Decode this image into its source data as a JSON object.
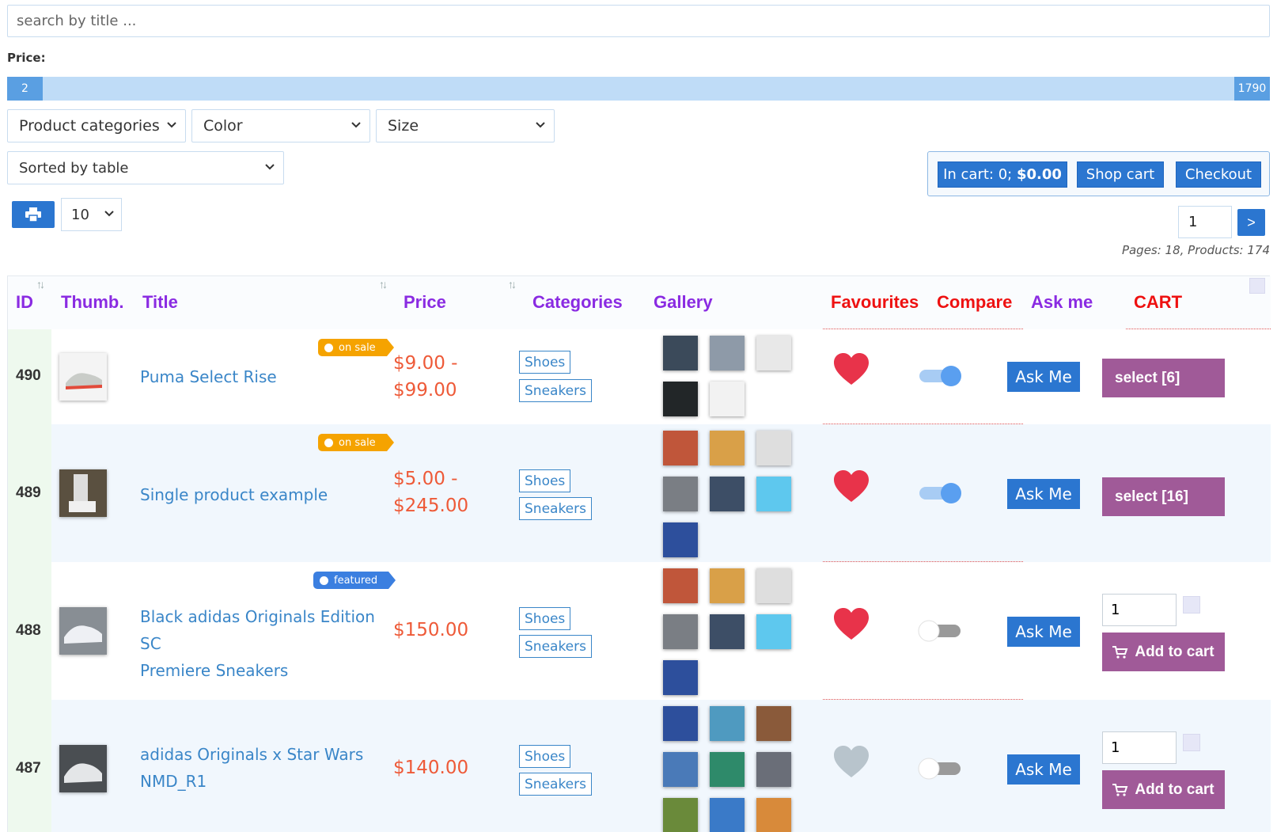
{
  "search": {
    "placeholder": "search by title ..."
  },
  "price": {
    "label": "Price:",
    "min": "2",
    "max": "1790"
  },
  "filters": {
    "categories": "Product categories",
    "color": "Color",
    "size": "Size"
  },
  "sort": {
    "selected": "Sorted by table"
  },
  "cart": {
    "in_cart_prefix": "In cart: 0; ",
    "in_cart_total": "$0.00",
    "shop_cart": "Shop cart",
    "checkout": "Checkout"
  },
  "per_page": {
    "selected": "10"
  },
  "pagination": {
    "page": "1",
    "next": ">",
    "info": "Pages: 18, Products: 174"
  },
  "table": {
    "headers": {
      "id": "ID",
      "thumb": "Thumb.",
      "title": "Title",
      "price": "Price",
      "categories": "Categories",
      "gallery": "Gallery",
      "favourites": "Favourites",
      "compare": "Compare",
      "ask": "Ask me",
      "cart": "CART"
    },
    "rows": [
      {
        "id": "490",
        "title": "Puma Select Rise",
        "badge": "on sale",
        "price_line1": "$9.00 -",
        "price_line2": "$99.00",
        "cat1": "Shoes",
        "cat2": "Sneakers",
        "ask": "Ask Me",
        "cart_label": "select [6]",
        "favourite": true,
        "compare": true
      },
      {
        "id": "489",
        "title": "Single product example",
        "badge": "on sale",
        "price_line1": "$5.00 -",
        "price_line2": "$245.00",
        "cat1": "Shoes",
        "cat2": "Sneakers",
        "ask": "Ask Me",
        "cart_label": "select [16]",
        "favourite": true,
        "compare": true
      },
      {
        "id": "488",
        "title_line1": "Black adidas Originals Edition SC",
        "title_line2": "Premiere Sneakers",
        "badge": "featured",
        "price": "$150.00",
        "cat1": "Shoes",
        "cat2": "Sneakers",
        "ask": "Ask Me",
        "qty": "1",
        "cart_label": "Add to cart",
        "favourite": true,
        "compare": false
      },
      {
        "id": "487",
        "title_line1": "adidas Originals x Star Wars",
        "title_line2": "NMD_R1",
        "price": "$140.00",
        "cat1": "Shoes",
        "cat2": "Sneakers",
        "ask": "Ask Me",
        "qty": "1",
        "cart_label": "Add to cart",
        "favourite": false,
        "compare": false
      }
    ]
  },
  "colors": {
    "accent": "#2b76d0",
    "purple_header": "#8a2be2",
    "red_header": "#ee1111",
    "price": "#ee5a38",
    "cart_button": "#a05a98",
    "heart_active": "#e8334a",
    "heart_inactive": "#b8c4cc"
  }
}
